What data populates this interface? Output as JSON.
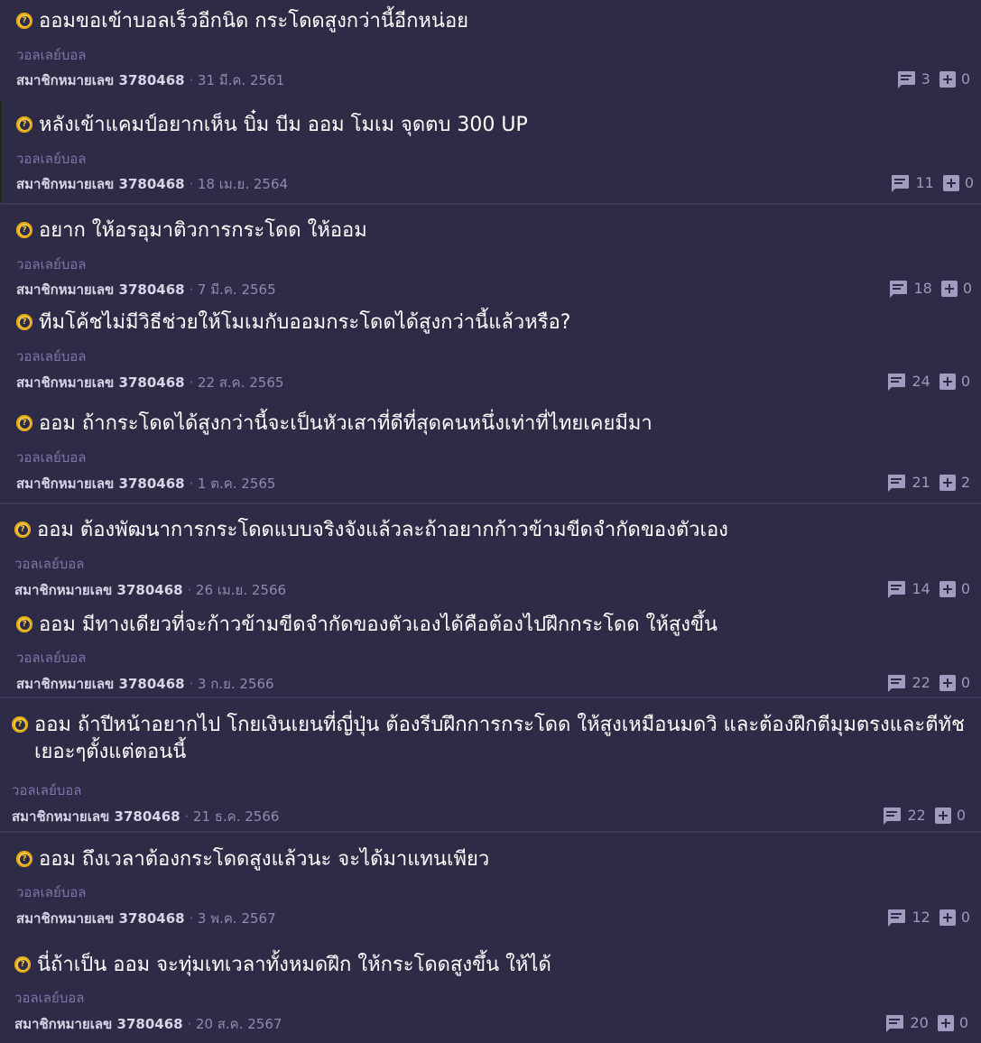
{
  "topics": [
    {
      "title": "ออมขอเข้าบอลเร็วอีกนิด กระโดดสูงกว่านี้อีกหน่อย",
      "tag": "วอลเลย์บอล",
      "author": "สมาชิกหมายเลข 3780468",
      "date": "31 มี.ค. 2561",
      "comments": "3",
      "votes": "0"
    },
    {
      "title": "หลังเข้าแคมป์อยากเห็น บิ๋ม บีม ออม โมเม จุดตบ 300 UP",
      "tag": "วอลเลย์บอล",
      "author": "สมาชิกหมายเลข 3780468",
      "date": "18 เม.ย. 2564",
      "comments": "11",
      "votes": "0"
    },
    {
      "title": "อยาก ให้อรอุมาติวการกระโดด ให้ออม",
      "tag": "วอลเลย์บอล",
      "author": "สมาชิกหมายเลข 3780468",
      "date": "7 มี.ค. 2565",
      "comments": "18",
      "votes": "0"
    },
    {
      "title": "ทีมโค้ชไม่มีวิธีช่วยให้โมเมกับออมกระโดดได้สูงกว่านี้แล้วหรือ?",
      "tag": "วอลเลย์บอล",
      "author": "สมาชิกหมายเลข 3780468",
      "date": "22 ส.ค. 2565",
      "comments": "24",
      "votes": "0"
    },
    {
      "title": "ออม ถ้ากระโดดได้สูงกว่านี้จะเป็นหัวเสาที่ดีที่สุดคนหนึ่งเท่าที่ไทยเคยมีมา",
      "tag": "วอลเลย์บอล",
      "author": "สมาชิกหมายเลข 3780468",
      "date": "1 ต.ค. 2565",
      "comments": "21",
      "votes": "2"
    },
    {
      "title": "ออม ต้องพัฒนาการกระโดดแบบจริงจังแล้วละถ้าอยากก้าวข้ามขีดจำกัดของตัวเอง",
      "tag": "วอลเลย์บอล",
      "author": "สมาชิกหมายเลข 3780468",
      "date": "26 เม.ย. 2566",
      "comments": "14",
      "votes": "0"
    },
    {
      "title": "ออม มีทางเดียวที่จะก้าวข้ามขีดจำกัดของตัวเองได้คือต้องไปฝึกกระโดด ให้สูงขึ้น",
      "tag": "วอลเลย์บอล",
      "author": "สมาชิกหมายเลข 3780468",
      "date": "3 ก.ย. 2566",
      "comments": "22",
      "votes": "0"
    },
    {
      "title": "ออม ถ้าปีหน้าอยากไป โกยเงินเยนที่ญี่ปุ่น ต้องรีบฝึกการกระโดด ให้สูงเหมือนมดวิ และต้องฝึกตีมุมตรงและตีทัชเยอะๆตั้งแต่ตอนนี้",
      "tag": "วอลเลย์บอล",
      "author": "สมาชิกหมายเลข 3780468",
      "date": "21 ธ.ค. 2566",
      "comments": "22",
      "votes": "0"
    },
    {
      "title": "ออม ถึงเวลาต้องกระโดดสูงแล้วนะ จะได้มาแทนเพียว",
      "tag": "วอลเลย์บอล",
      "author": "สมาชิกหมายเลข 3780468",
      "date": "3 พ.ค. 2567",
      "comments": "12",
      "votes": "0"
    },
    {
      "title": "นี่ถ้าเป็น ออม จะทุ่มเทเวลาทั้งหมดฝึก ให้กระโดดสูงขึ้น ให้ได้",
      "tag": "วอลเลย์บอล",
      "author": "สมาชิกหมายเลข 3780468",
      "date": "20 ส.ค. 2567",
      "comments": "20",
      "votes": "0"
    }
  ],
  "colors": {
    "background": "#2d2b46",
    "separator": "#3b3957",
    "title": "#ffffff",
    "tag": "#7b76a8",
    "meta": "#c7c5d9",
    "counts": "#9c98bd",
    "question_icon": "#f5c93b"
  },
  "icons": {
    "topic_type": "question-icon",
    "comments": "comment-icon",
    "votes": "plus-box-icon"
  }
}
